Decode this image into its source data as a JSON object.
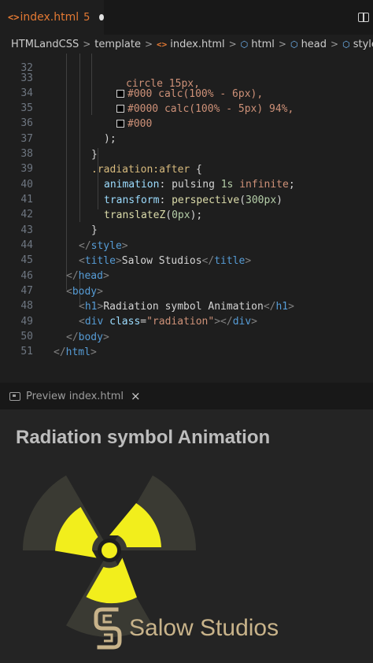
{
  "tab": {
    "icon": "<>",
    "filename": "index.html",
    "problems": "5",
    "unsaved_indicator": "dot"
  },
  "breadcrumb": {
    "items": [
      {
        "icon": "",
        "label": "HTMLandCSS"
      },
      {
        "icon": "",
        "label": "template"
      },
      {
        "icon": "code-icon",
        "label": "index.html"
      },
      {
        "icon": "cube-icon",
        "label": "html"
      },
      {
        "icon": "cube-icon",
        "label": "head"
      },
      {
        "icon": "cube-icon",
        "label": "style"
      }
    ]
  },
  "editor": {
    "line_numbers": [
      "32",
      "33",
      "34",
      "35",
      "36",
      "37",
      "38",
      "39",
      "40",
      "41",
      "42",
      "43",
      "44",
      "45",
      "46",
      "47",
      "48",
      "49",
      "50",
      "51"
    ],
    "code": {
      "l32": "circle 15px,",
      "l33": {
        "color": "#000 calc(100% - 6px),",
        "swatch": "#000000"
      },
      "l34": {
        "color": "#0000 calc(100% - 5px) 94%,",
        "swatch": "#000000"
      },
      "l35": {
        "color": "#000",
        "swatch": "#000000"
      },
      "l36": ");",
      "l37": "}",
      "l38": {
        "selector": ".radiation:after",
        "brace": " {"
      },
      "l39": {
        "prop": "animation",
        "sep": ": ",
        "v1": "pulsing",
        "v2": " 1s",
        "v3": " infinite",
        "end": ";"
      },
      "l40": {
        "prop": "transform",
        "sep": ": ",
        "fn": "perspective",
        "open": "(",
        "num": "300px",
        "close": ")"
      },
      "l41": {
        "fn": "translateZ",
        "open": "(",
        "num": "0px",
        "close": ");"
      },
      "l42": "}",
      "l43": {
        "open": "</",
        "tag": "style",
        "close": ">"
      },
      "l44": {
        "tag": "title",
        "text": "Salow Studios",
        "end_tag": "title"
      },
      "l45": {
        "open": "</",
        "tag": "head",
        "close": ">"
      },
      "l46": {
        "open": "<",
        "tag": "body",
        "close": ">"
      },
      "l47": {
        "tag": "h1",
        "text": "Radiation symbol Animation",
        "end_tag": "h1"
      },
      "l48": {
        "tag": "div",
        "attr": "class",
        "eq": "=",
        "value": "\"radiation\"",
        "end_tag": "div"
      },
      "l49": {
        "open": "</",
        "tag": "body",
        "close": ">"
      },
      "l50": {
        "open": "</",
        "tag": "html",
        "close": ">"
      }
    }
  },
  "preview_panel": {
    "tab_label": "Preview index.html",
    "close_label": "×",
    "heading": "Radiation symbol Animation",
    "symbol_colors": {
      "blades": "#f2ee1c",
      "center": "#f2ee1c",
      "shadow": "#3a3a33"
    },
    "watermark": "Salow Studios"
  },
  "colors": {
    "editor_bg": "#1e1e1e",
    "accent_orange": "#e37933",
    "icon_blue": "#75beff",
    "watermark_gold": "#c8b38a"
  }
}
